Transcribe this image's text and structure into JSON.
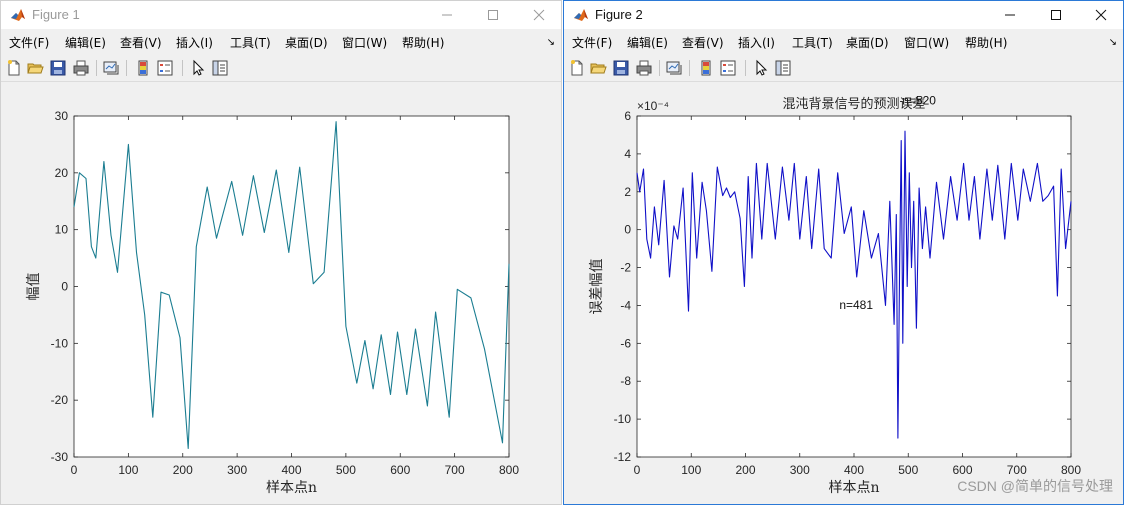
{
  "menu": [
    "文件(F)",
    "编辑(E)",
    "查看(V)",
    "插入(I)",
    "工具(T)",
    "桌面(D)",
    "窗口(W)",
    "帮助(H)"
  ],
  "figure1": {
    "window_title": "Figure 1",
    "chart_data": {
      "type": "line",
      "xlabel": "样本点n",
      "ylabel": "幅值",
      "xlim": [
        0,
        800
      ],
      "ylim": [
        -30,
        30
      ],
      "xticks": [
        "0",
        "100",
        "200",
        "300",
        "400",
        "500",
        "600",
        "700",
        "800"
      ],
      "yticks": [
        "30",
        "20",
        "10",
        "0",
        "-10",
        "-20",
        "-30"
      ],
      "series_color": "#1b7d91",
      "x": [
        0,
        10,
        22,
        32,
        40,
        55,
        68,
        80,
        100,
        115,
        130,
        145,
        160,
        175,
        195,
        210,
        225,
        245,
        262,
        290,
        310,
        330,
        350,
        372,
        395,
        415,
        440,
        460,
        482,
        500,
        520,
        535,
        550,
        565,
        582,
        595,
        612,
        628,
        650,
        665,
        690,
        705,
        730,
        755,
        788,
        800
      ],
      "y": [
        14,
        20,
        19,
        7,
        5,
        22,
        9,
        2.5,
        25,
        6,
        -5,
        -23,
        -1,
        -1.5,
        -9,
        -28.5,
        7,
        17.5,
        8.5,
        18.5,
        9,
        19.5,
        9.5,
        20.5,
        6,
        21,
        0.5,
        2.5,
        29,
        -7,
        -17,
        -9.5,
        -18,
        -8.5,
        -19,
        -8,
        -19,
        -7.5,
        -21,
        -4.5,
        -23,
        -0.5,
        -2,
        -11,
        -27.5,
        4
      ]
    }
  },
  "figure2": {
    "window_title": "Figure 2",
    "chart_data": {
      "type": "line",
      "title": "混沌背景信号的预测误差",
      "xlabel": "样本点n",
      "ylabel": "误差幅值",
      "exponent_label": "×10⁻⁴",
      "xlim": [
        0,
        800
      ],
      "ylim": [
        -12,
        6
      ],
      "xticks": [
        "0",
        "100",
        "200",
        "300",
        "400",
        "500",
        "600",
        "700",
        "800"
      ],
      "yticks": [
        "6",
        "4",
        "2",
        "0",
        "-2",
        "-4",
        "-6",
        "-8",
        "-10",
        "-12"
      ],
      "series_color": "#1010c8",
      "annotations": [
        {
          "text": "n=520",
          "x": 520,
          "y": 6.6
        },
        {
          "text": "n=481",
          "x": 404,
          "y": -4.2
        }
      ],
      "x": [
        0,
        5,
        12,
        18,
        25,
        32,
        40,
        50,
        60,
        68,
        75,
        85,
        95,
        102,
        110,
        120,
        128,
        138,
        148,
        158,
        165,
        172,
        180,
        190,
        198,
        205,
        212,
        220,
        230,
        240,
        255,
        268,
        280,
        290,
        300,
        312,
        322,
        335,
        345,
        358,
        370,
        382,
        395,
        405,
        418,
        432,
        445,
        458,
        466,
        474,
        478,
        481,
        484,
        487,
        490,
        494,
        498,
        502,
        506,
        510,
        515,
        520,
        526,
        532,
        540,
        552,
        565,
        578,
        590,
        602,
        612,
        622,
        632,
        645,
        655,
        665,
        678,
        690,
        702,
        712,
        725,
        738,
        748,
        758,
        768,
        775,
        782,
        790,
        800
      ],
      "y": [
        3,
        2,
        3.2,
        -0.5,
        -1.5,
        1.2,
        -0.8,
        2.6,
        -2.5,
        0.2,
        -0.5,
        2.2,
        -4.3,
        3,
        -1.5,
        2.5,
        1,
        -2.2,
        3.3,
        1.8,
        2.2,
        1.7,
        2,
        0.6,
        -3,
        2.8,
        -1.5,
        3.5,
        -0.5,
        3.5,
        -0.5,
        3.3,
        0.5,
        3.5,
        -0.5,
        2.8,
        -1,
        3.2,
        -1,
        -1.5,
        3,
        -0.2,
        1.2,
        -2.5,
        1,
        -1.5,
        -0.2,
        -4,
        1.5,
        -5,
        0.8,
        -11,
        -2,
        4.7,
        -6,
        5.2,
        -3,
        3,
        -2,
        1.5,
        -5.2,
        2.2,
        -1,
        1.2,
        -1.5,
        2.5,
        -0.5,
        2.8,
        0.5,
        3.5,
        0.5,
        2.8,
        -0.5,
        3.2,
        0.5,
        3.4,
        -0.5,
        3.5,
        0.5,
        3.2,
        1.5,
        3.5,
        1.5,
        1.8,
        2.3,
        -3.5,
        3.2,
        -1,
        1.5
      ]
    }
  },
  "watermark": "CSDN @简单的信号处理"
}
